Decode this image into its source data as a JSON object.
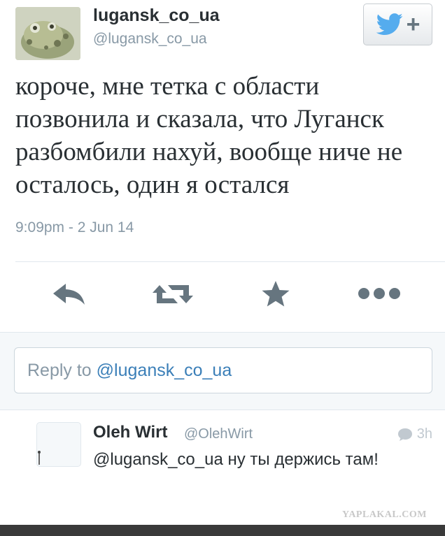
{
  "tweet": {
    "author_name": "lugansk_co_ua",
    "author_handle": "@lugansk_co_ua",
    "text": "короче, мне тетка с области позвонила и сказала, что Луганск разбомбили нахуй, вообще ниче не осталось, один я остался",
    "timestamp": "9:09pm - 2 Jun 14",
    "follow_button_icon": "twitter-bird-plus-icon"
  },
  "actions": {
    "reply_icon": "reply-icon",
    "retweet_icon": "retweet-icon",
    "favorite_icon": "star-icon",
    "more_icon": "more-dots-icon"
  },
  "reply_box": {
    "prefix": "Reply to ",
    "mention": "@lugansk_co_ua"
  },
  "reply": {
    "author_name": "Oleh Wirt",
    "author_handle": "@OlehWirt",
    "time": "3h",
    "text": "@lugansk_co_ua ну ты держись там!"
  },
  "watermark": "YAPLAKAL.COM",
  "colors": {
    "twitter_blue": "#55acee",
    "mention_blue": "#3b7fb8",
    "secondary_text": "#8899a6",
    "icon_gray": "#66757f"
  }
}
